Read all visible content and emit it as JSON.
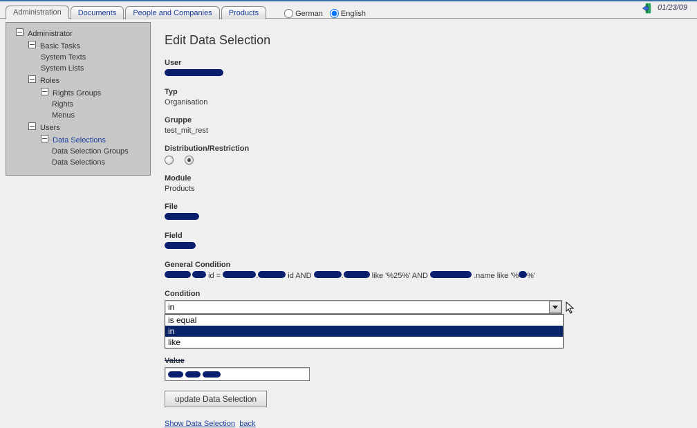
{
  "header": {
    "tabs": [
      {
        "label": "Administration",
        "active": true
      },
      {
        "label": "Documents",
        "active": false
      },
      {
        "label": "People and Companies",
        "active": false
      },
      {
        "label": "Products",
        "active": false
      }
    ],
    "lang": {
      "german": "German",
      "english": "English",
      "selected": "english"
    },
    "date": "01/23/09"
  },
  "tree": {
    "root": "Administrator",
    "items": [
      {
        "label": "Basic Tasks",
        "level": 2,
        "toggle": true
      },
      {
        "label": "System Texts",
        "level": 3,
        "toggle": false
      },
      {
        "label": "System Lists",
        "level": 3,
        "toggle": false
      },
      {
        "label": "Roles",
        "level": 2,
        "toggle": true
      },
      {
        "label": "Rights Groups",
        "level": 3,
        "toggle": true
      },
      {
        "label": "Rights",
        "level": 4,
        "toggle": false
      },
      {
        "label": "Menus",
        "level": 4,
        "toggle": false
      },
      {
        "label": "Users",
        "level": 2,
        "toggle": true
      },
      {
        "label": "Data Selections",
        "level": 3,
        "toggle": true,
        "selected": true
      },
      {
        "label": "Data Selection Groups",
        "level": 4,
        "toggle": false
      },
      {
        "label": "Data Selections",
        "level": 4,
        "toggle": false
      }
    ]
  },
  "page": {
    "title": "Edit Data Selection",
    "userLbl": "User",
    "typLbl": "Typ",
    "typVal": "Organisation",
    "gruppeLbl": "Gruppe",
    "gruppeVal": "test_mit_rest",
    "distLbl": "Distribution/Restriction",
    "moduleLbl": "Module",
    "moduleVal": "Products",
    "fileLbl": "File",
    "fieldLbl": "Field",
    "genCondLbl": "General Condition",
    "genCond": {
      "p1": "id = ",
      " p2": " id AND ",
      "p3": " like '%25%' AND ",
      "p4": ".name like '%",
      "p5": "%'"
    },
    "condLbl": "Condition",
    "condSelected": "in",
    "condOptions": [
      "is equal",
      "in",
      "like"
    ],
    "valueLbl": "Value",
    "updateBtn": "update Data Selection",
    "linkShow": "Show Data Selection",
    "linkBack": "back"
  }
}
